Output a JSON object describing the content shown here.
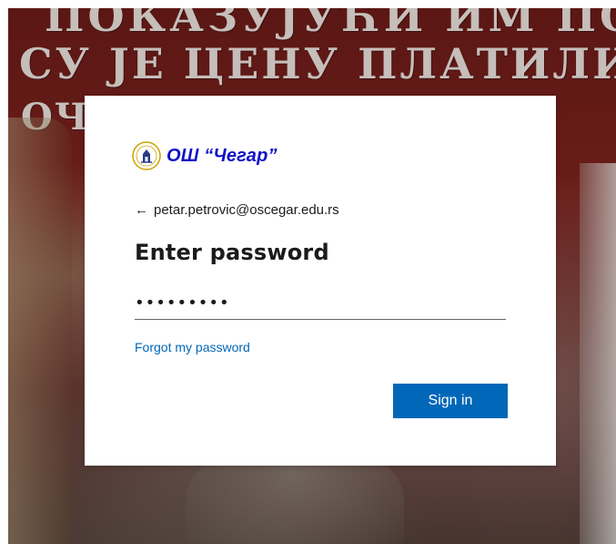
{
  "background": {
    "inscription_lines": [
      "ПОКАЗУЈУЋИ ИМ ПО НАЊУ",
      "СУ ЈЕ ЦЕНУ ПЛАТИЛИ ЊИХОВИ",
      "ОЧ"
    ]
  },
  "brand": {
    "name": "ОШ “Чегар”",
    "logo_icon": "school-seal-icon",
    "color": "#1010c8"
  },
  "identity": {
    "back_icon": "back-arrow-icon",
    "back_glyph": "←",
    "email": "petar.petrovic@oscegar.edu.rs"
  },
  "form": {
    "title": "Enter password",
    "password_value": "•••••••••",
    "forgot_label": "Forgot my password",
    "signin_label": "Sign in"
  },
  "colors": {
    "accent": "#0067b8",
    "text": "#1b1b1b",
    "link": "#0067b8"
  }
}
